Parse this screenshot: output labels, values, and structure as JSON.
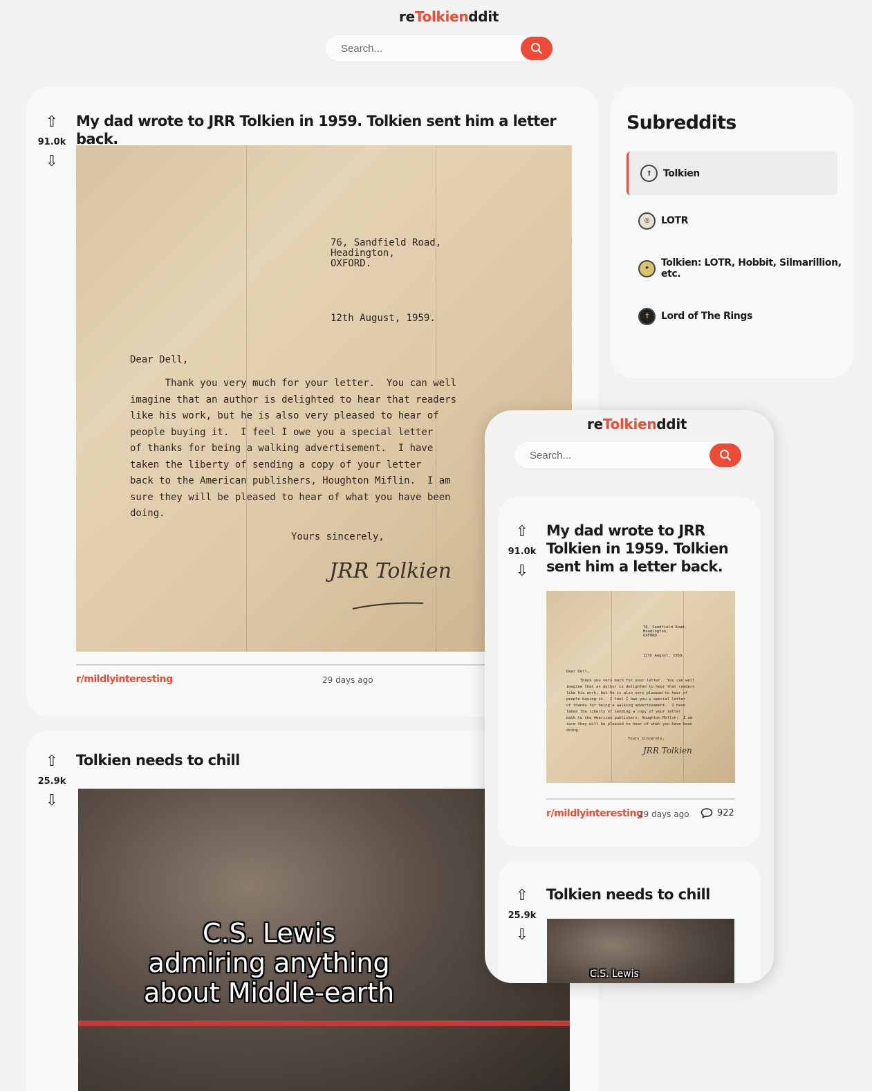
{
  "app": {
    "logo_prefix": "re",
    "logo_middle": "Tolkien",
    "logo_suffix": "ddit",
    "accent_color": "#ee4a35"
  },
  "search": {
    "placeholder": "Search...",
    "button_icon": "search-icon"
  },
  "posts": [
    {
      "title": "My dad wrote to JRR Tolkien in 1959. Tolkien sent him a letter back.",
      "score": "91.0k",
      "subreddit": "r/mildlyinteresting",
      "time": "29 days ago",
      "comments": "922",
      "letter": {
        "address": "76, Sandfield Road,\nHeadington,\nOXFORD.",
        "date": "12th August, 1959.",
        "salutation": "Dear Dell,",
        "body": "      Thank you very much for your letter.  You can well\nimagine that an author is delighted to hear that readers\nlike his work, but he is also very pleased to hear of\npeople buying it.  I feel I owe you a special letter\nof thanks for being a walking advertisement.  I have\ntaken the liberty of sending a copy of your letter\nback to the American publishers, Houghton Miflin.  I am\nsure they will be pleased to hear of what you have been\ndoing.",
        "closing": "Yours sincerely,",
        "signature": "JRRTolkien"
      }
    },
    {
      "title": "Tolkien needs to chill",
      "score": "25.9k",
      "meme_caption": [
        "C.S. Lewis",
        "admiring anything",
        "about Middle-earth"
      ]
    }
  ],
  "sidebar": {
    "title": "Subreddits",
    "items": [
      {
        "label": "Tolkien",
        "icon": "tolkien-icon",
        "active": true
      },
      {
        "label": "LOTR",
        "icon": "lotr-icon",
        "active": false
      },
      {
        "label": "Tolkien: LOTR, Hobbit, Silmarillion, etc.",
        "icon": "tolkien-fans-icon",
        "active": false
      },
      {
        "label": "Lord of The Rings",
        "icon": "lord-of-the-rings-icon",
        "active": false
      }
    ]
  }
}
